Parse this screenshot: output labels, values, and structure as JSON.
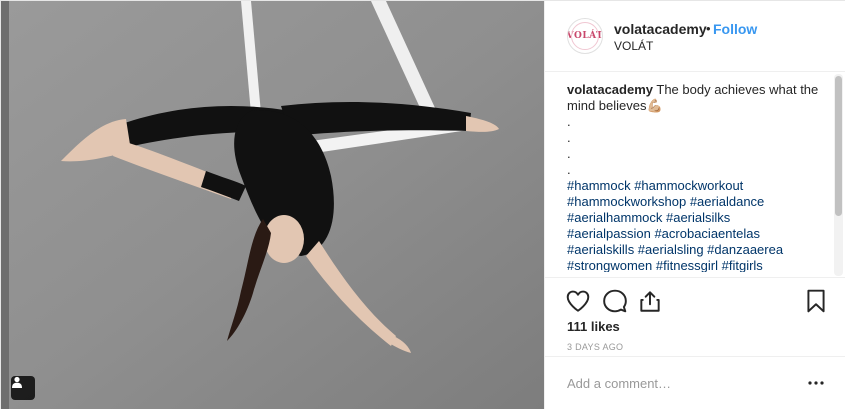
{
  "post": {
    "username": "volatacademy",
    "separator": "•",
    "follow_label": "Follow",
    "location": "VOLÁT",
    "avatar_text": "VOLÁT",
    "caption_text": "The body achieves what the mind believes💪🏼",
    "caption_dots": [
      ".",
      ".",
      ".",
      "."
    ],
    "hashtag_lines": [
      "#hammock #hammockworkout",
      "#hammockworkshop #aerialdance",
      "#aerialhammock #aerialsilks",
      "#aerialpassion #acrobaciaentelas",
      "#aerialskills #aerialsling #danzaaerea",
      "#strongwomen #fitnessgirl #fitgirls"
    ],
    "likes_label": "111 likes",
    "time_label": "3 DAYS AGO",
    "comment_placeholder": "Add a comment…",
    "more_label": "•••"
  },
  "icons": {
    "like": "heart-icon",
    "comment": "comment-bubble-icon",
    "share": "share-icon",
    "save": "bookmark-icon",
    "user_tags": "person-icon",
    "more": "more-options-icon"
  },
  "colors": {
    "follow": "#3897f0",
    "hashtag": "#003569",
    "meta": "#999999",
    "border": "#efefef"
  }
}
